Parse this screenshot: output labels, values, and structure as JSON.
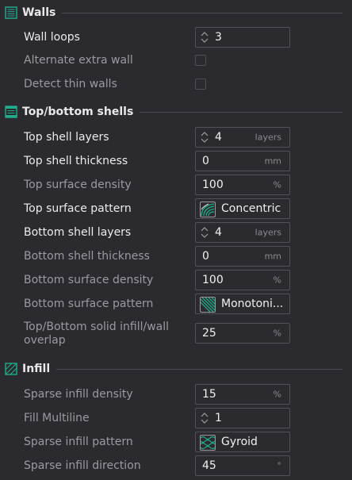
{
  "sections": {
    "walls": {
      "title": "Walls",
      "icon": "walls-icon"
    },
    "shells": {
      "title": "Top/bottom shells",
      "icon": "shells-icon"
    },
    "infill": {
      "title": "Infill",
      "icon": "infill-icon"
    }
  },
  "walls": {
    "wall_loops": {
      "label": "Wall loops",
      "value": "3"
    },
    "alternate_extra_wall": {
      "label": "Alternate extra wall",
      "checked": false
    },
    "detect_thin_walls": {
      "label": "Detect thin walls",
      "checked": false
    }
  },
  "shells": {
    "top_shell_layers": {
      "label": "Top shell layers",
      "value": "4",
      "unit": "layers"
    },
    "top_shell_thickness": {
      "label": "Top shell thickness",
      "value": "0",
      "unit": "mm"
    },
    "top_surface_density": {
      "label": "Top surface density",
      "value": "100",
      "unit": "%"
    },
    "top_surface_pattern": {
      "label": "Top surface pattern",
      "value": "Concentric",
      "icon": "concentric-pattern-icon"
    },
    "bottom_shell_layers": {
      "label": "Bottom shell layers",
      "value": "4",
      "unit": "layers"
    },
    "bottom_shell_thickness": {
      "label": "Bottom shell thickness",
      "value": "0",
      "unit": "mm"
    },
    "bottom_surface_density": {
      "label": "Bottom surface density",
      "value": "100",
      "unit": "%"
    },
    "bottom_surface_pattern": {
      "label": "Bottom surface pattern",
      "value": "Monotoni...",
      "icon": "monotonic-pattern-icon"
    },
    "solid_infill_overlap": {
      "label_line1": "Top/Bottom solid infill/wall",
      "label_line2": "overlap",
      "value": "25",
      "unit": "%"
    }
  },
  "infill": {
    "sparse_infill_density": {
      "label": "Sparse infill density",
      "value": "15",
      "unit": "%"
    },
    "fill_multiline": {
      "label": "Fill Multiline",
      "value": "1"
    },
    "sparse_infill_pattern": {
      "label": "Sparse infill pattern",
      "value": "Gyroid",
      "icon": "gyroid-pattern-icon"
    },
    "sparse_infill_direction": {
      "label": "Sparse infill direction",
      "value": "45",
      "unit": "°"
    }
  },
  "colors": {
    "background": "#2b2b2f",
    "accent": "#1fae8c",
    "bright_label": "#ececec",
    "dim_label": "#9a9aa0",
    "field_border": "#505056"
  }
}
